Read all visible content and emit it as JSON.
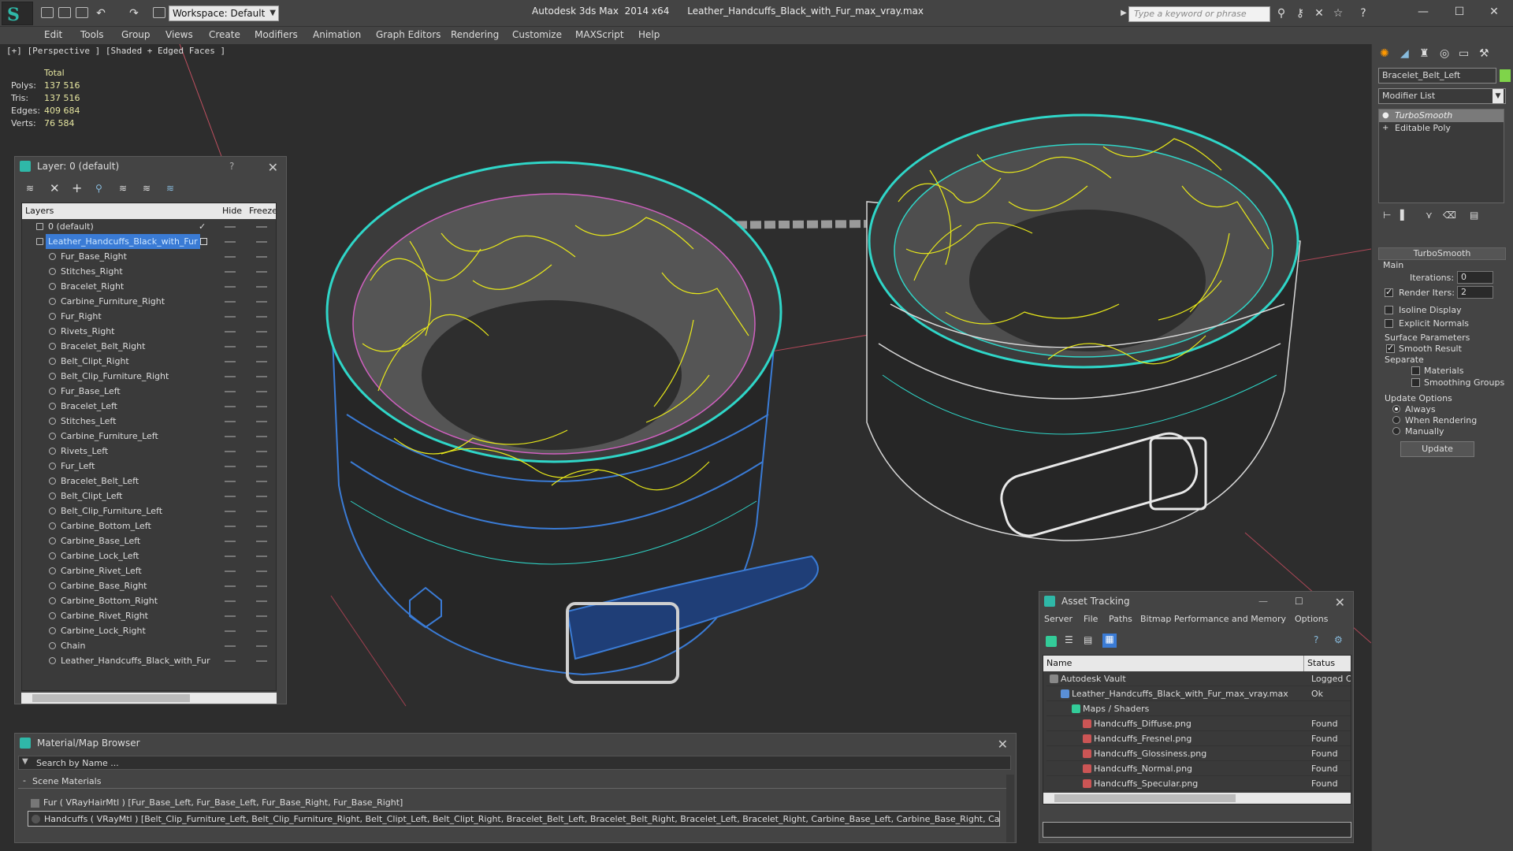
{
  "app": {
    "title": "Autodesk 3ds Max  2014 x64",
    "file": "Leather_Handcuffs_Black_with_Fur_max_vray.max",
    "workspace": "Workspace: Default",
    "search_placeholder": "Type a keyword or phrase"
  },
  "menu": [
    "Edit",
    "Tools",
    "Group",
    "Views",
    "Create",
    "Modifiers",
    "Animation",
    "Graph Editors",
    "Rendering",
    "Customize",
    "MAXScript",
    "Help"
  ],
  "viewport": {
    "label": "[+] [Perspective ] [Shaded + Edged Faces ]",
    "stats": {
      "header": "Total",
      "rows": [
        {
          "k": "Polys:",
          "v": "137 516"
        },
        {
          "k": "Tris:",
          "v": "137 516"
        },
        {
          "k": "Edges:",
          "v": "409 684"
        },
        {
          "k": "Verts:",
          "v": "76 584"
        }
      ]
    }
  },
  "layer_panel": {
    "title": "Layer: 0 (default)",
    "help": "?",
    "columns": {
      "layers": "Layers",
      "hide": "Hide",
      "freeze": "Freeze"
    },
    "rows": [
      {
        "name": "0 (default)",
        "top": true
      },
      {
        "name": "Leather_Handcuffs_Black_with_Fur",
        "top": true,
        "selected": true
      },
      {
        "name": "Fur_Base_Right"
      },
      {
        "name": "Stitches_Right"
      },
      {
        "name": "Bracelet_Right"
      },
      {
        "name": "Carbine_Furniture_Right"
      },
      {
        "name": "Fur_Right"
      },
      {
        "name": "Rivets_Right"
      },
      {
        "name": "Bracelet_Belt_Right"
      },
      {
        "name": "Belt_Clipt_Right"
      },
      {
        "name": "Belt_Clip_Furniture_Right"
      },
      {
        "name": "Fur_Base_Left"
      },
      {
        "name": "Bracelet_Left"
      },
      {
        "name": "Stitches_Left"
      },
      {
        "name": "Carbine_Furniture_Left"
      },
      {
        "name": "Rivets_Left"
      },
      {
        "name": "Fur_Left"
      },
      {
        "name": "Bracelet_Belt_Left"
      },
      {
        "name": "Belt_Clipt_Left"
      },
      {
        "name": "Belt_Clip_Furniture_Left"
      },
      {
        "name": "Carbine_Bottom_Left"
      },
      {
        "name": "Carbine_Base_Left"
      },
      {
        "name": "Carbine_Lock_Left"
      },
      {
        "name": "Carbine_Rivet_Left"
      },
      {
        "name": "Carbine_Base_Right"
      },
      {
        "name": "Carbine_Bottom_Right"
      },
      {
        "name": "Carbine_Rivet_Right"
      },
      {
        "name": "Carbine_Lock_Right"
      },
      {
        "name": "Chain"
      },
      {
        "name": "Leather_Handcuffs_Black_with_Fur"
      }
    ]
  },
  "material_browser": {
    "title": "Material/Map Browser",
    "search_placeholder": "Search by Name ...",
    "section": "Scene Materials",
    "rows": [
      "Fur  ( VRayHairMtl )  [Fur_Base_Left, Fur_Base_Left, Fur_Base_Right, Fur_Base_Right]",
      "Handcuffs  ( VRayMtl )  [Belt_Clip_Furniture_Left, Belt_Clip_Furniture_Right, Belt_Clipt_Left, Belt_Clipt_Right, Bracelet_Belt_Left, Bracelet_Belt_Right, Bracelet_Left, Bracelet_Right, Carbine_Base_Left, Carbine_Base_Right, Carbine_Bottom_..."
    ]
  },
  "asset_tracking": {
    "title": "Asset Tracking",
    "menu": [
      "Server",
      "File",
      "Paths",
      "Bitmap Performance and Memory",
      "Options"
    ],
    "columns": {
      "name": "Name",
      "status": "Status"
    },
    "rows": [
      {
        "name": "Autodesk Vault",
        "status": "Logged O",
        "level": 0
      },
      {
        "name": "Leather_Handcuffs_Black_with_Fur_max_vray.max",
        "status": "Ok",
        "level": 1
      },
      {
        "name": "Maps / Shaders",
        "status": "",
        "level": 2
      },
      {
        "name": "Handcuffs_Diffuse.png",
        "status": "Found",
        "level": 3
      },
      {
        "name": "Handcuffs_Fresnel.png",
        "status": "Found",
        "level": 3
      },
      {
        "name": "Handcuffs_Glossiness.png",
        "status": "Found",
        "level": 3
      },
      {
        "name": "Handcuffs_Normal.png",
        "status": "Found",
        "level": 3
      },
      {
        "name": "Handcuffs_Specular.png",
        "status": "Found",
        "level": 3
      }
    ]
  },
  "command_panel": {
    "object_name": "Bracelet_Belt_Left",
    "object_color": "#7fd44a",
    "modifier_list": "Modifier List",
    "stack": [
      "TurboSmooth",
      "Editable Poly"
    ],
    "rollout": "TurboSmooth",
    "main": "Main",
    "iterations_label": "Iterations:",
    "iterations": "0",
    "render_iters_label": "Render Iters:",
    "render_iters": "2",
    "isoline": "Isoline Display",
    "explicit_normals": "Explicit Normals",
    "surface_params": "Surface Parameters",
    "smooth_result": "Smooth Result",
    "separate": "Separate",
    "materials": "Materials",
    "smoothing_groups": "Smoothing Groups",
    "update_options": "Update Options",
    "always": "Always",
    "when_rendering": "When Rendering",
    "manually": "Manually",
    "update_button": "Update"
  },
  "colors": {
    "fur": "#e8e81a",
    "wire_cyan": "#2fd6c8",
    "wire_blue": "#3a7bd5",
    "selection": "#3a7bd5"
  }
}
